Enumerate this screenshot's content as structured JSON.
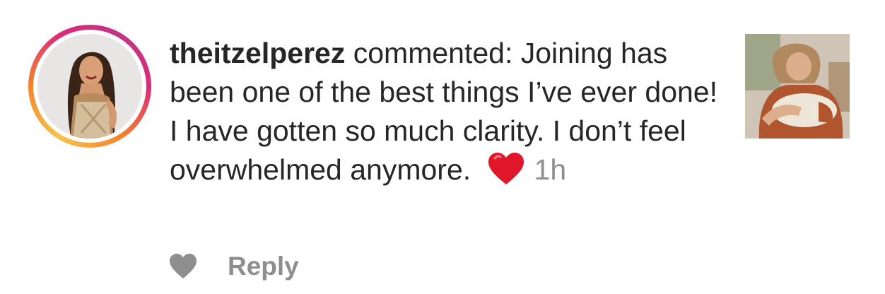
{
  "comment": {
    "username": "theitzelperez",
    "text": " commented: Joining has been one of the best things I’ve ever done! I have gotten so much clarity. I don’t feel overwhelmed anymore.",
    "emoji_icon": "red-heart-emoji",
    "timestamp": "1h"
  },
  "actions": {
    "like_icon": "heart-icon",
    "reply_label": "Reply"
  },
  "colors": {
    "text": "#262626",
    "muted": "#8e8e8e",
    "emoji_red": "#e0172b",
    "story_ring": [
      "#f9c24b",
      "#f58529",
      "#dd2a7b",
      "#c13584"
    ]
  }
}
